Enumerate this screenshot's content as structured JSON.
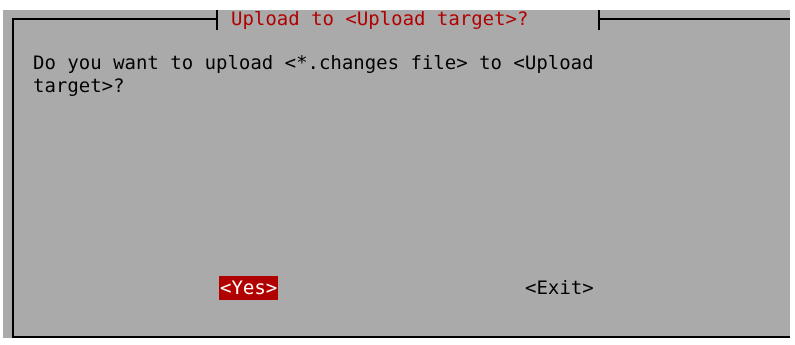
{
  "dialog": {
    "title": "Upload to <Upload target>?",
    "message": "Do you want to upload <*.changes file> to <Upload\ntarget>?",
    "buttons": {
      "yes_label": "<Yes>",
      "exit_label": "<Exit>"
    },
    "selected_button": "yes"
  },
  "colors": {
    "dialog_background": "#aaaaaa",
    "title_text": "#b00000",
    "selected_button_background": "#b00000",
    "selected_button_text": "#ffffff",
    "frame": "#000000"
  }
}
